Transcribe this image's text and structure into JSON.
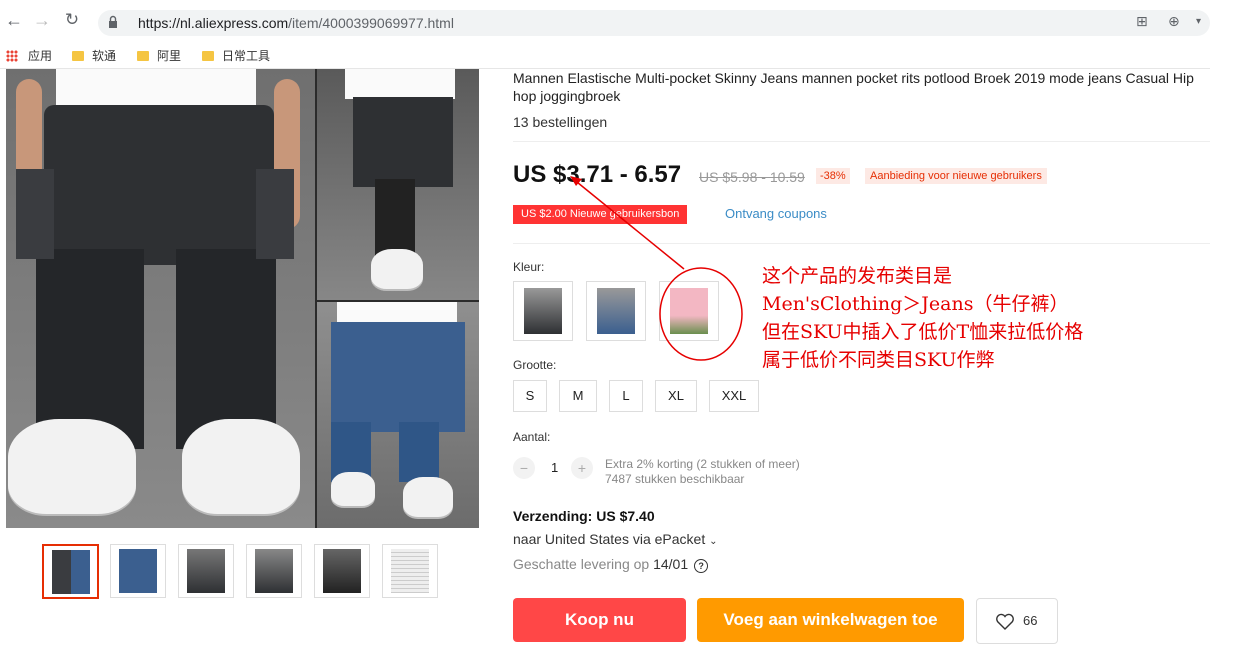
{
  "browser": {
    "url_host": "https://nl.aliexpress.com",
    "url_path": "/item/4000399069977.html",
    "bookmarks": [
      {
        "label": "应用"
      },
      {
        "label": "软通"
      },
      {
        "label": "阿里"
      },
      {
        "label": "日常工具"
      }
    ]
  },
  "product": {
    "title": "Mannen Elastische Multi-pocket Skinny Jeans mannen pocket rits potlood Broek 2019 mode jeans Casual Hip hop joggingbroek",
    "orders": "13 bestellingen",
    "price": "US $3.71 - 6.57",
    "original_price": "US $5.98 - 10.59",
    "discount": "-38%",
    "promo_badge": "Aanbieding voor nieuwe gebruikers",
    "coupon": "US $2.00 Nieuwe gebruikersbon",
    "coupon_link": "Ontvang coupons",
    "color_label": "Kleur:",
    "size_label": "Grootte:",
    "sizes": [
      "S",
      "M",
      "L",
      "XL",
      "XXL"
    ],
    "quantity_label": "Aantal:",
    "quantity": "1",
    "quantity_note1": "Extra 2% korting (2 stukken of meer)",
    "quantity_note2": "7487 stukken beschikbaar",
    "shipping": "Verzending: US $7.40",
    "shipping_via": "naar United States via ePacket",
    "eta_prefix": "Geschatte levering op",
    "eta_date": "14/01",
    "buy_label": "Koop nu",
    "cart_label": "Voeg aan winkelwagen toe",
    "wishlist_count": "66"
  },
  "annotation": {
    "lines": [
      "这个产品的发布类目是",
      "Men'sClothing＞Jeans（牛仔裤）",
      "但在SKU中插入了低价T恤来拉低价格",
      "属于低价不同类目SKU作弊"
    ],
    "color": "#e60000"
  },
  "colors": {
    "buy": "#ff4747",
    "cart": "#ff9a00",
    "accent": "#e62e04",
    "link": "#3b8cc6"
  }
}
